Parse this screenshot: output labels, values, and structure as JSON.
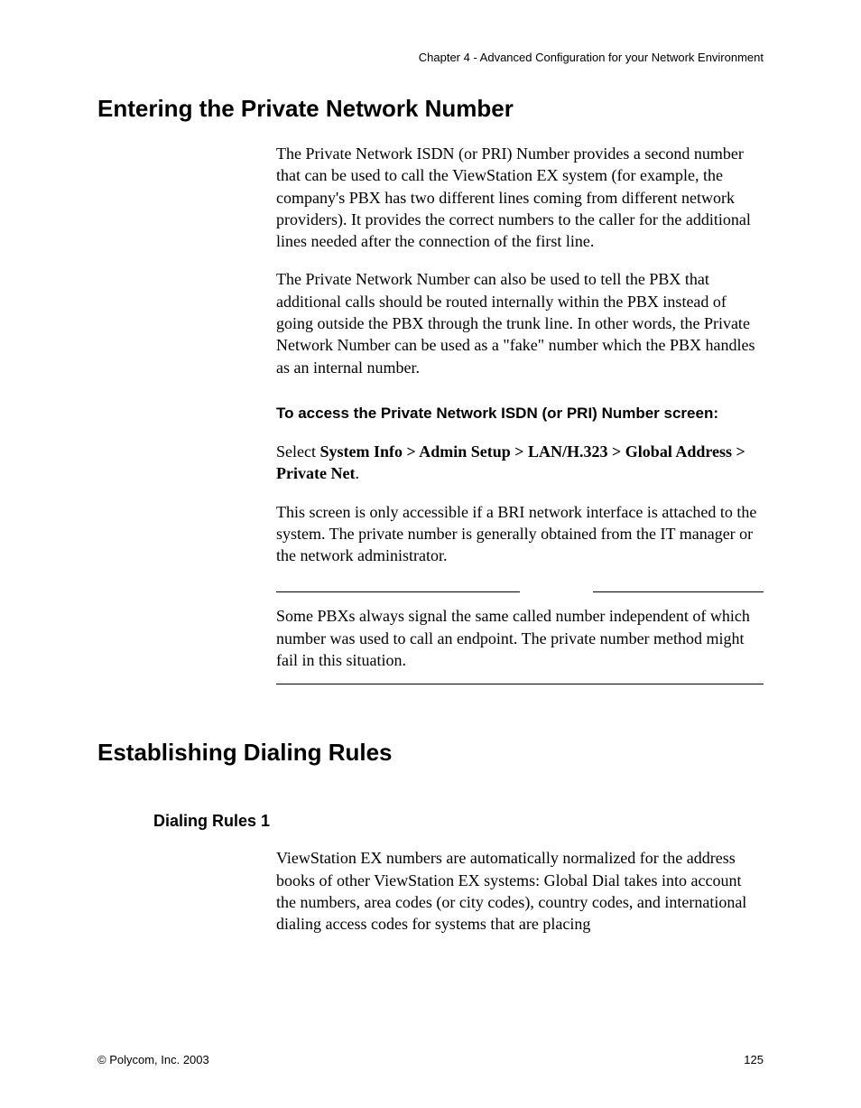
{
  "header": {
    "chapter": "Chapter 4 - Advanced Configuration for your Network Environment"
  },
  "section1": {
    "title": "Entering the Private Network Number",
    "p1": "The Private Network ISDN (or PRI) Number provides a second number that can be used to call the ViewStation EX system (for example, the company's PBX has two different lines coming from different network providers). It provides the correct numbers to the caller for the additional lines needed after the connection of the first line.",
    "p2": "The Private Network Number can also be used to tell the PBX that additional calls should be routed internally within the PBX instead of going outside the PBX through the trunk line. In other words, the Private Network Number can be used as a \"fake\" number which the PBX handles as an internal number.",
    "sub1": "To access the Private Network ISDN (or PRI) Number screen:",
    "p3_prefix": "Select ",
    "p3_bold": "System Info > Admin Setup > LAN/H.323 > Global Address > Private Net",
    "p3_suffix": ".",
    "p4": "This screen is only accessible if a BRI network interface is attached to the system. The private number is generally obtained from the IT manager or the network administrator.",
    "note": "Some PBXs always signal the same called number independent of which number was used to call an endpoint. The private number method might fail in this situation."
  },
  "section2": {
    "title": "Establishing Dialing Rules",
    "sub1": "Dialing Rules 1",
    "p1": "ViewStation EX numbers are automatically normalized for the address books of other ViewStation EX systems: Global Dial takes into account the numbers, area codes (or city codes), country codes, and international dialing access codes for systems that are placing"
  },
  "footer": {
    "copyright": "© Polycom, Inc. 2003",
    "page": "125"
  }
}
